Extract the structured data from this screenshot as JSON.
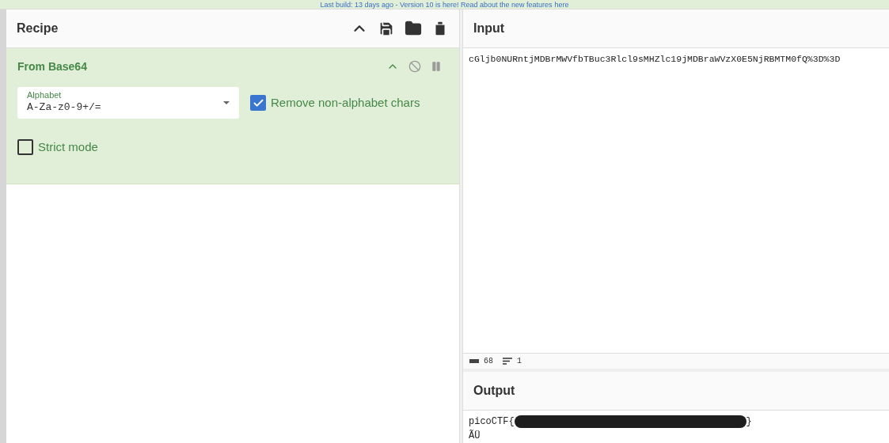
{
  "banner": {
    "text": "Last build: 13 days ago - Version 10 is here! Read about the new features",
    "link": "here"
  },
  "recipe": {
    "title": "Recipe",
    "operation": {
      "name": "From Base64",
      "disabled": false,
      "paused": false,
      "alphabet": {
        "label": "Alphabet",
        "value": "A-Za-z0-9+/="
      },
      "options": [
        {
          "label": "Remove non-alphabet chars",
          "checked": true
        },
        {
          "label": "Strict mode",
          "checked": false
        }
      ]
    }
  },
  "input": {
    "title": "Input",
    "value": "cGljb0NURntjMDBrMWVfbTBuc3Rlcl9sMHZlc19jMDBraWVzX0E5NjRBMTM0fQ%3D%3D",
    "length": "68",
    "lines": "1"
  },
  "output": {
    "title": "Output",
    "lines": [
      {
        "before": "picoCTF{",
        "redacted": true,
        "after": "}"
      },
      {
        "before": "ÃÜ",
        "redacted": false
      }
    ]
  }
}
